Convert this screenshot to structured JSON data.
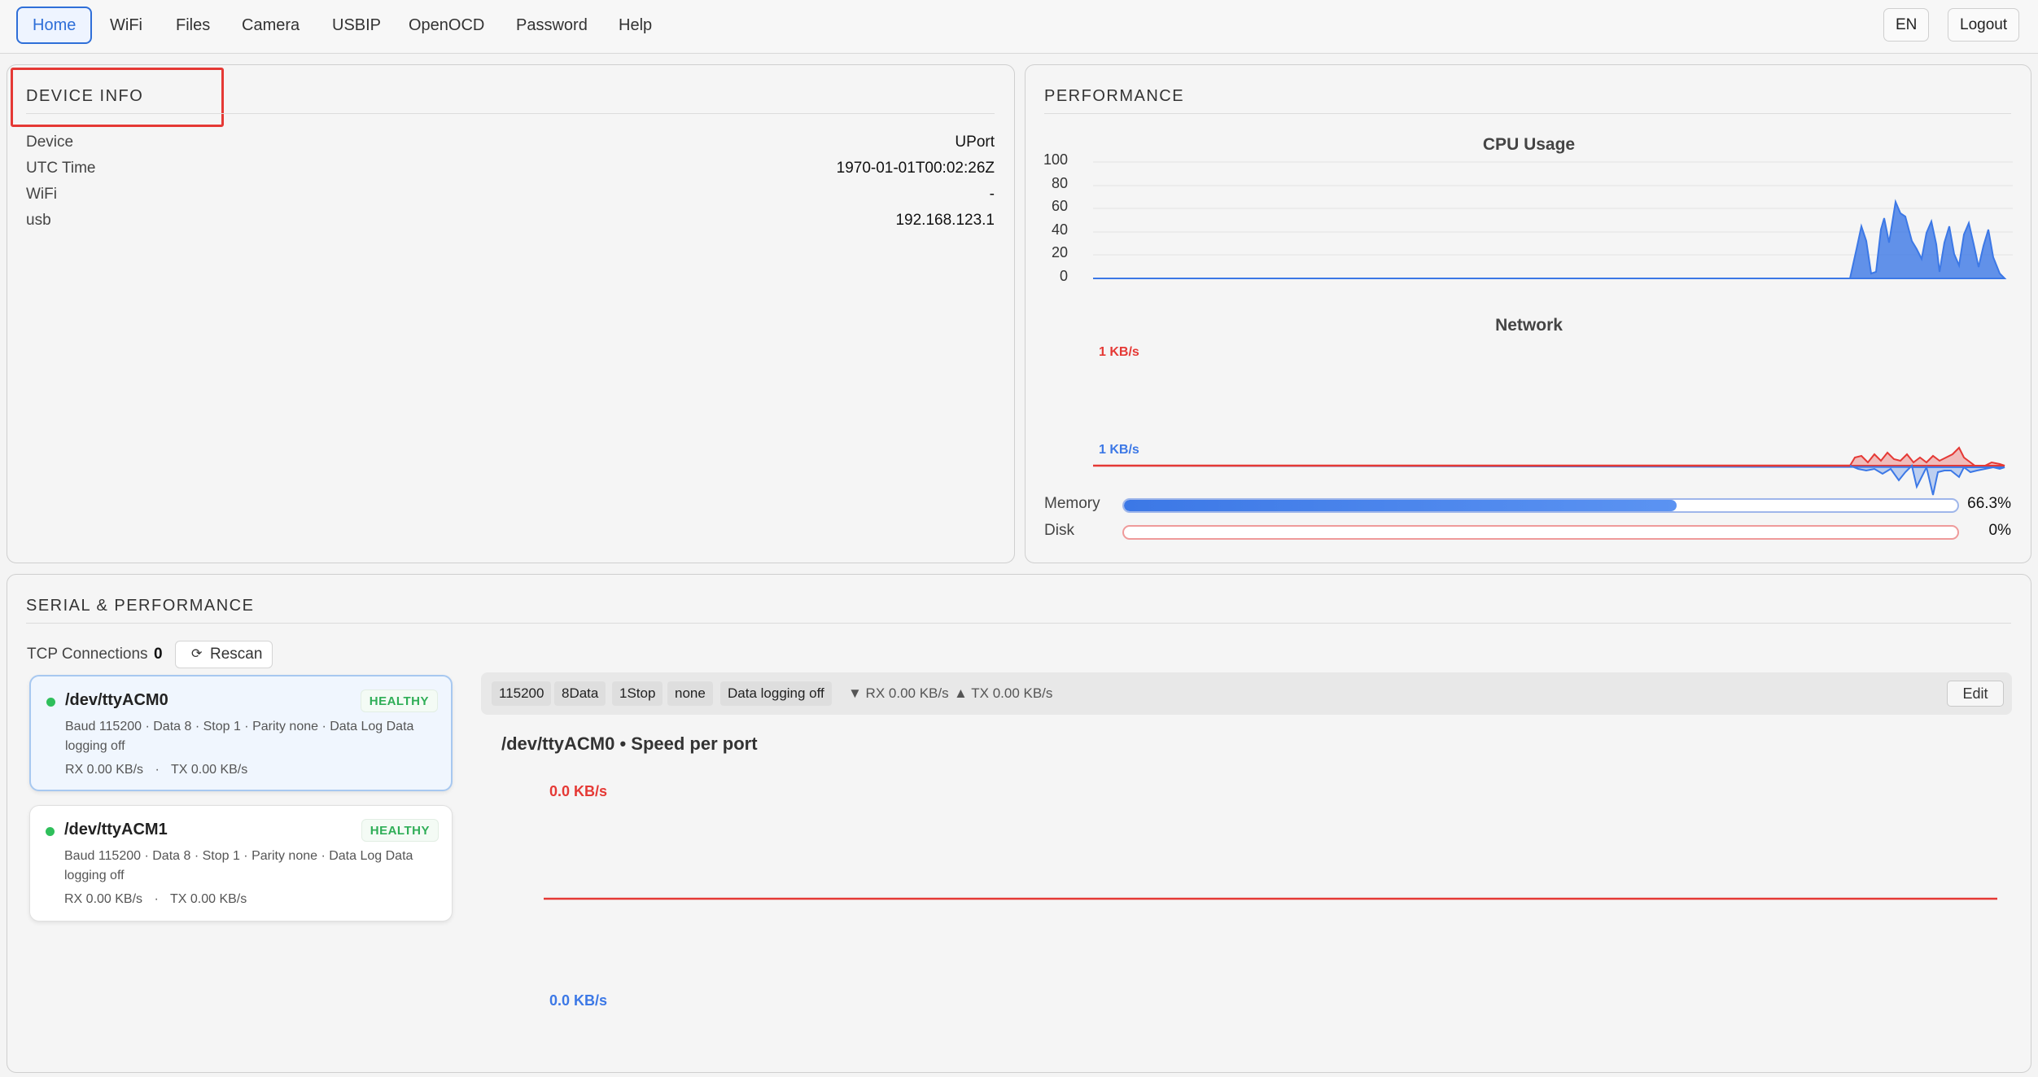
{
  "nav": {
    "tabs": [
      "Home",
      "WiFi",
      "Files",
      "Camera",
      "USBIP",
      "OpenOCD",
      "Password",
      "Help"
    ],
    "language": "EN",
    "logout": "Logout"
  },
  "device_info": {
    "title": "DEVICE INFO",
    "rows": [
      {
        "key": "Device",
        "value": "UPort"
      },
      {
        "key": "UTC Time",
        "value": "1970-01-01T00:02:26Z"
      },
      {
        "key": "WiFi",
        "value": "-"
      },
      {
        "key": "usb",
        "value": "192.168.123.1"
      }
    ]
  },
  "performance": {
    "title": "PERFORMANCE",
    "cpu_title": "CPU Usage",
    "cpu_ticks": [
      "100",
      "80",
      "60",
      "40",
      "20",
      "0"
    ],
    "network_title": "Network",
    "network_tx_label": "1 KB/s",
    "network_rx_label": "1 KB/s",
    "memory_label": "Memory",
    "memory_pct": "66.3%",
    "memory_value": 0.663,
    "disk_label": "Disk",
    "disk_pct": "0%",
    "disk_value": 0,
    "colors": {
      "cpu": "#3c78e6",
      "tx": "#e53935",
      "rx": "#3c78e6"
    }
  },
  "serial": {
    "title": "SERIAL & PERFORMANCE",
    "tcp_label": "TCP Connections",
    "tcp_count": "0",
    "rescan": "Rescan",
    "ports": [
      {
        "name": "/dev/ttyACM0",
        "status": "HEALTHY",
        "desc": "Baud 115200 · Data 8 · Stop 1 · Parity none · Data Log Data logging off",
        "rx": "RX 0.00 KB/s",
        "sep": "·",
        "tx": "TX 0.00 KB/s"
      },
      {
        "name": "/dev/ttyACM1",
        "status": "HEALTHY",
        "desc": "Baud 115200 · Data 8 · Stop 1 · Parity none · Data Log Data logging off",
        "rx": "RX 0.00 KB/s",
        "sep": "·",
        "tx": "TX 0.00 KB/s"
      }
    ],
    "config_chips": [
      "115200",
      "8Data",
      "1Stop",
      "none",
      "Data logging off"
    ],
    "rx_rate": "▼ RX 0.00 KB/s",
    "tx_rate": "▲ TX 0.00 KB/s",
    "edit": "Edit",
    "speed_title": "/dev/ttyACM0 • Speed per port",
    "speed_tx_label": "0.0 KB/s",
    "speed_rx_label": "0.0 KB/s"
  }
}
